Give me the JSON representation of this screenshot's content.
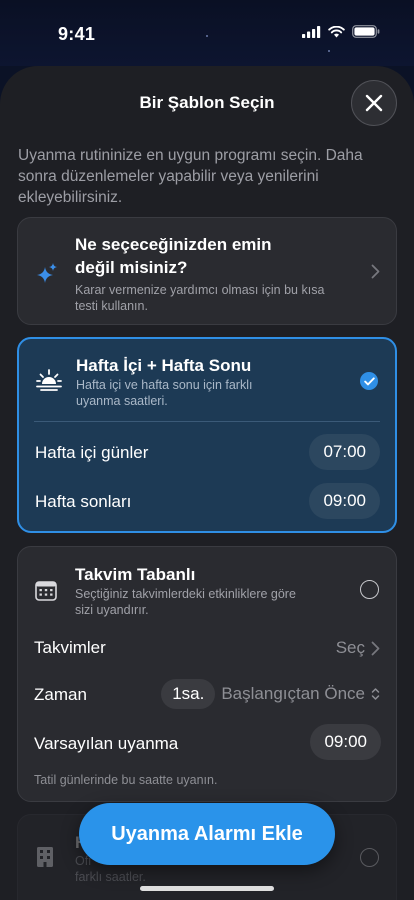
{
  "status_bar": {
    "time": "9:41"
  },
  "sheet": {
    "title": "Bir Şablon Seçin",
    "subtitle": "Uyanma rutininize en uygun programı seçin. Daha sonra düzenlemeler yapabilir veya yenilerini ekleyebilirsiniz."
  },
  "quiz_card": {
    "title_line1": "Ne seçeceğinizden emin",
    "title_line2": "değil misiniz?",
    "desc_line1": "Karar vermenize yardımcı olması için bu kısa",
    "desc_line2": "testi kullanın.",
    "icon": "sparkles-icon"
  },
  "weekday_weekend_card": {
    "title": "Hafta İçi + Hafta Sonu",
    "desc_line1": "Hafta içi ve hafta sonu için farklı",
    "desc_line2": "uyanma saatleri.",
    "icon": "sunrise-icon",
    "selected": true,
    "rows": [
      {
        "label": "Hafta içi günler",
        "value": "07:00"
      },
      {
        "label": "Hafta sonları",
        "value": "09:00"
      }
    ]
  },
  "calendar_card": {
    "title": "Takvim Tabanlı",
    "desc_line1": "Seçtiğiniz takvimlerdeki etkinliklere göre",
    "desc_line2": "sizi uyandırır.",
    "icon": "calendar-icon",
    "selected": false,
    "calendars_label": "Takvimler",
    "calendars_value": "Seç",
    "time_label": "Zaman",
    "time_amount": "1sa.",
    "time_mode": "Başlangıçtan Önce",
    "default_label": "Varsayılan uyanma",
    "default_value": "09:00",
    "note": "Tatil günlerinde bu saatte uyanın."
  },
  "partial_card": {
    "title_fragment": "H",
    "desc_line1_fragment": "Ofi",
    "desc_line2": "farklı saatler.",
    "icon": "building-icon"
  },
  "cta": {
    "label": "Uyanma Alarmı Ekle"
  },
  "colors": {
    "accent": "#2a93ea",
    "sheet": "#1e1f24",
    "selected_card": "#1d3a55"
  }
}
